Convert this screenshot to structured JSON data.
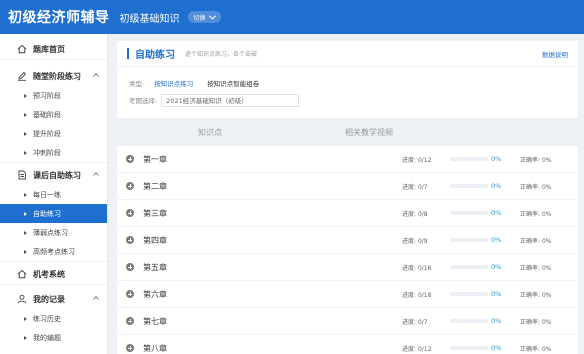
{
  "header": {
    "app_title": "初级经济师辅导",
    "subtitle": "初级基础知识",
    "switch_label": "切换"
  },
  "sidebar": {
    "home": "题库首页",
    "groups": [
      {
        "label": "随堂阶段练习",
        "icon": "pen-icon",
        "items": [
          "预习阶段",
          "基础阶段",
          "提升阶段",
          "冲刺阶段"
        ]
      },
      {
        "label": "课后自助练习",
        "icon": "document-icon",
        "items": [
          "每日一练",
          "自助练习",
          "薄弱点练习",
          "高频考点练习"
        ]
      },
      {
        "label": "机考系统",
        "icon": "home-icon",
        "items": []
      },
      {
        "label": "我的记录",
        "icon": "user-icon",
        "items": [
          "练习历史",
          "我的编题"
        ]
      }
    ],
    "active_item": "自助练习"
  },
  "main": {
    "title": "自助练习",
    "description": "逐个知识点练习，各个击破",
    "help_link": "数据说明",
    "filter_label": "类型:",
    "filter_options": [
      "按知识点练习",
      "按知识点智能组卷"
    ],
    "period_label": "考期选择:",
    "period_value": "2021经济基础知识（初级）",
    "table_headers": [
      "知识点",
      "相关教学视频"
    ],
    "progress_label": "进度:",
    "accuracy_label": "正确率:",
    "rows": [
      {
        "chapter": "第一章",
        "progress": "0/12",
        "percent": "0%",
        "percent_value": 0,
        "accuracy": "0%"
      },
      {
        "chapter": "第二章",
        "progress": "0/7",
        "percent": "0%",
        "percent_value": 0,
        "accuracy": "0%"
      },
      {
        "chapter": "第三章",
        "progress": "0/8",
        "percent": "0%",
        "percent_value": 0,
        "accuracy": "0%"
      },
      {
        "chapter": "第四章",
        "progress": "0/9",
        "percent": "0%",
        "percent_value": 0,
        "accuracy": "0%"
      },
      {
        "chapter": "第五章",
        "progress": "0/16",
        "percent": "0%",
        "percent_value": 0,
        "accuracy": "0%"
      },
      {
        "chapter": "第六章",
        "progress": "0/18",
        "percent": "0%",
        "percent_value": 0,
        "accuracy": "0%"
      },
      {
        "chapter": "第七章",
        "progress": "0/7",
        "percent": "0%",
        "percent_value": 0,
        "accuracy": "0%"
      },
      {
        "chapter": "第八章",
        "progress": "0/12",
        "percent": "0%",
        "percent_value": 0,
        "accuracy": "0%"
      }
    ]
  },
  "colors": {
    "brand": "#1f6fd1",
    "percent": "#1f9bd1"
  }
}
